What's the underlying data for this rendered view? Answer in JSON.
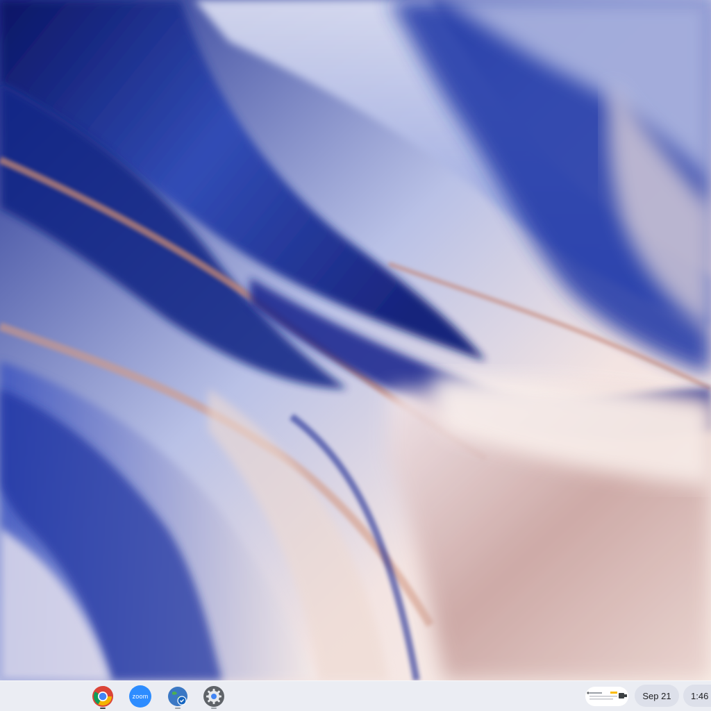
{
  "wallpaper": {
    "colors": [
      "#0b1a6e",
      "#2c46b0",
      "#8f9fd9",
      "#e9d8d8",
      "#c98a74",
      "#fbeee8"
    ]
  },
  "shelf": {
    "apps": [
      {
        "name": "Chrome",
        "icon": "chrome-icon",
        "running": true
      },
      {
        "name": "Zoom",
        "icon": "zoom-icon",
        "label": "zoom",
        "running": false
      },
      {
        "name": "Google Earth",
        "icon": "earth-icon",
        "running": true
      },
      {
        "name": "Settings",
        "icon": "settings-gear-icon",
        "running": true
      }
    ],
    "tray": {
      "date": "Sep 21",
      "time": "1:46"
    }
  }
}
